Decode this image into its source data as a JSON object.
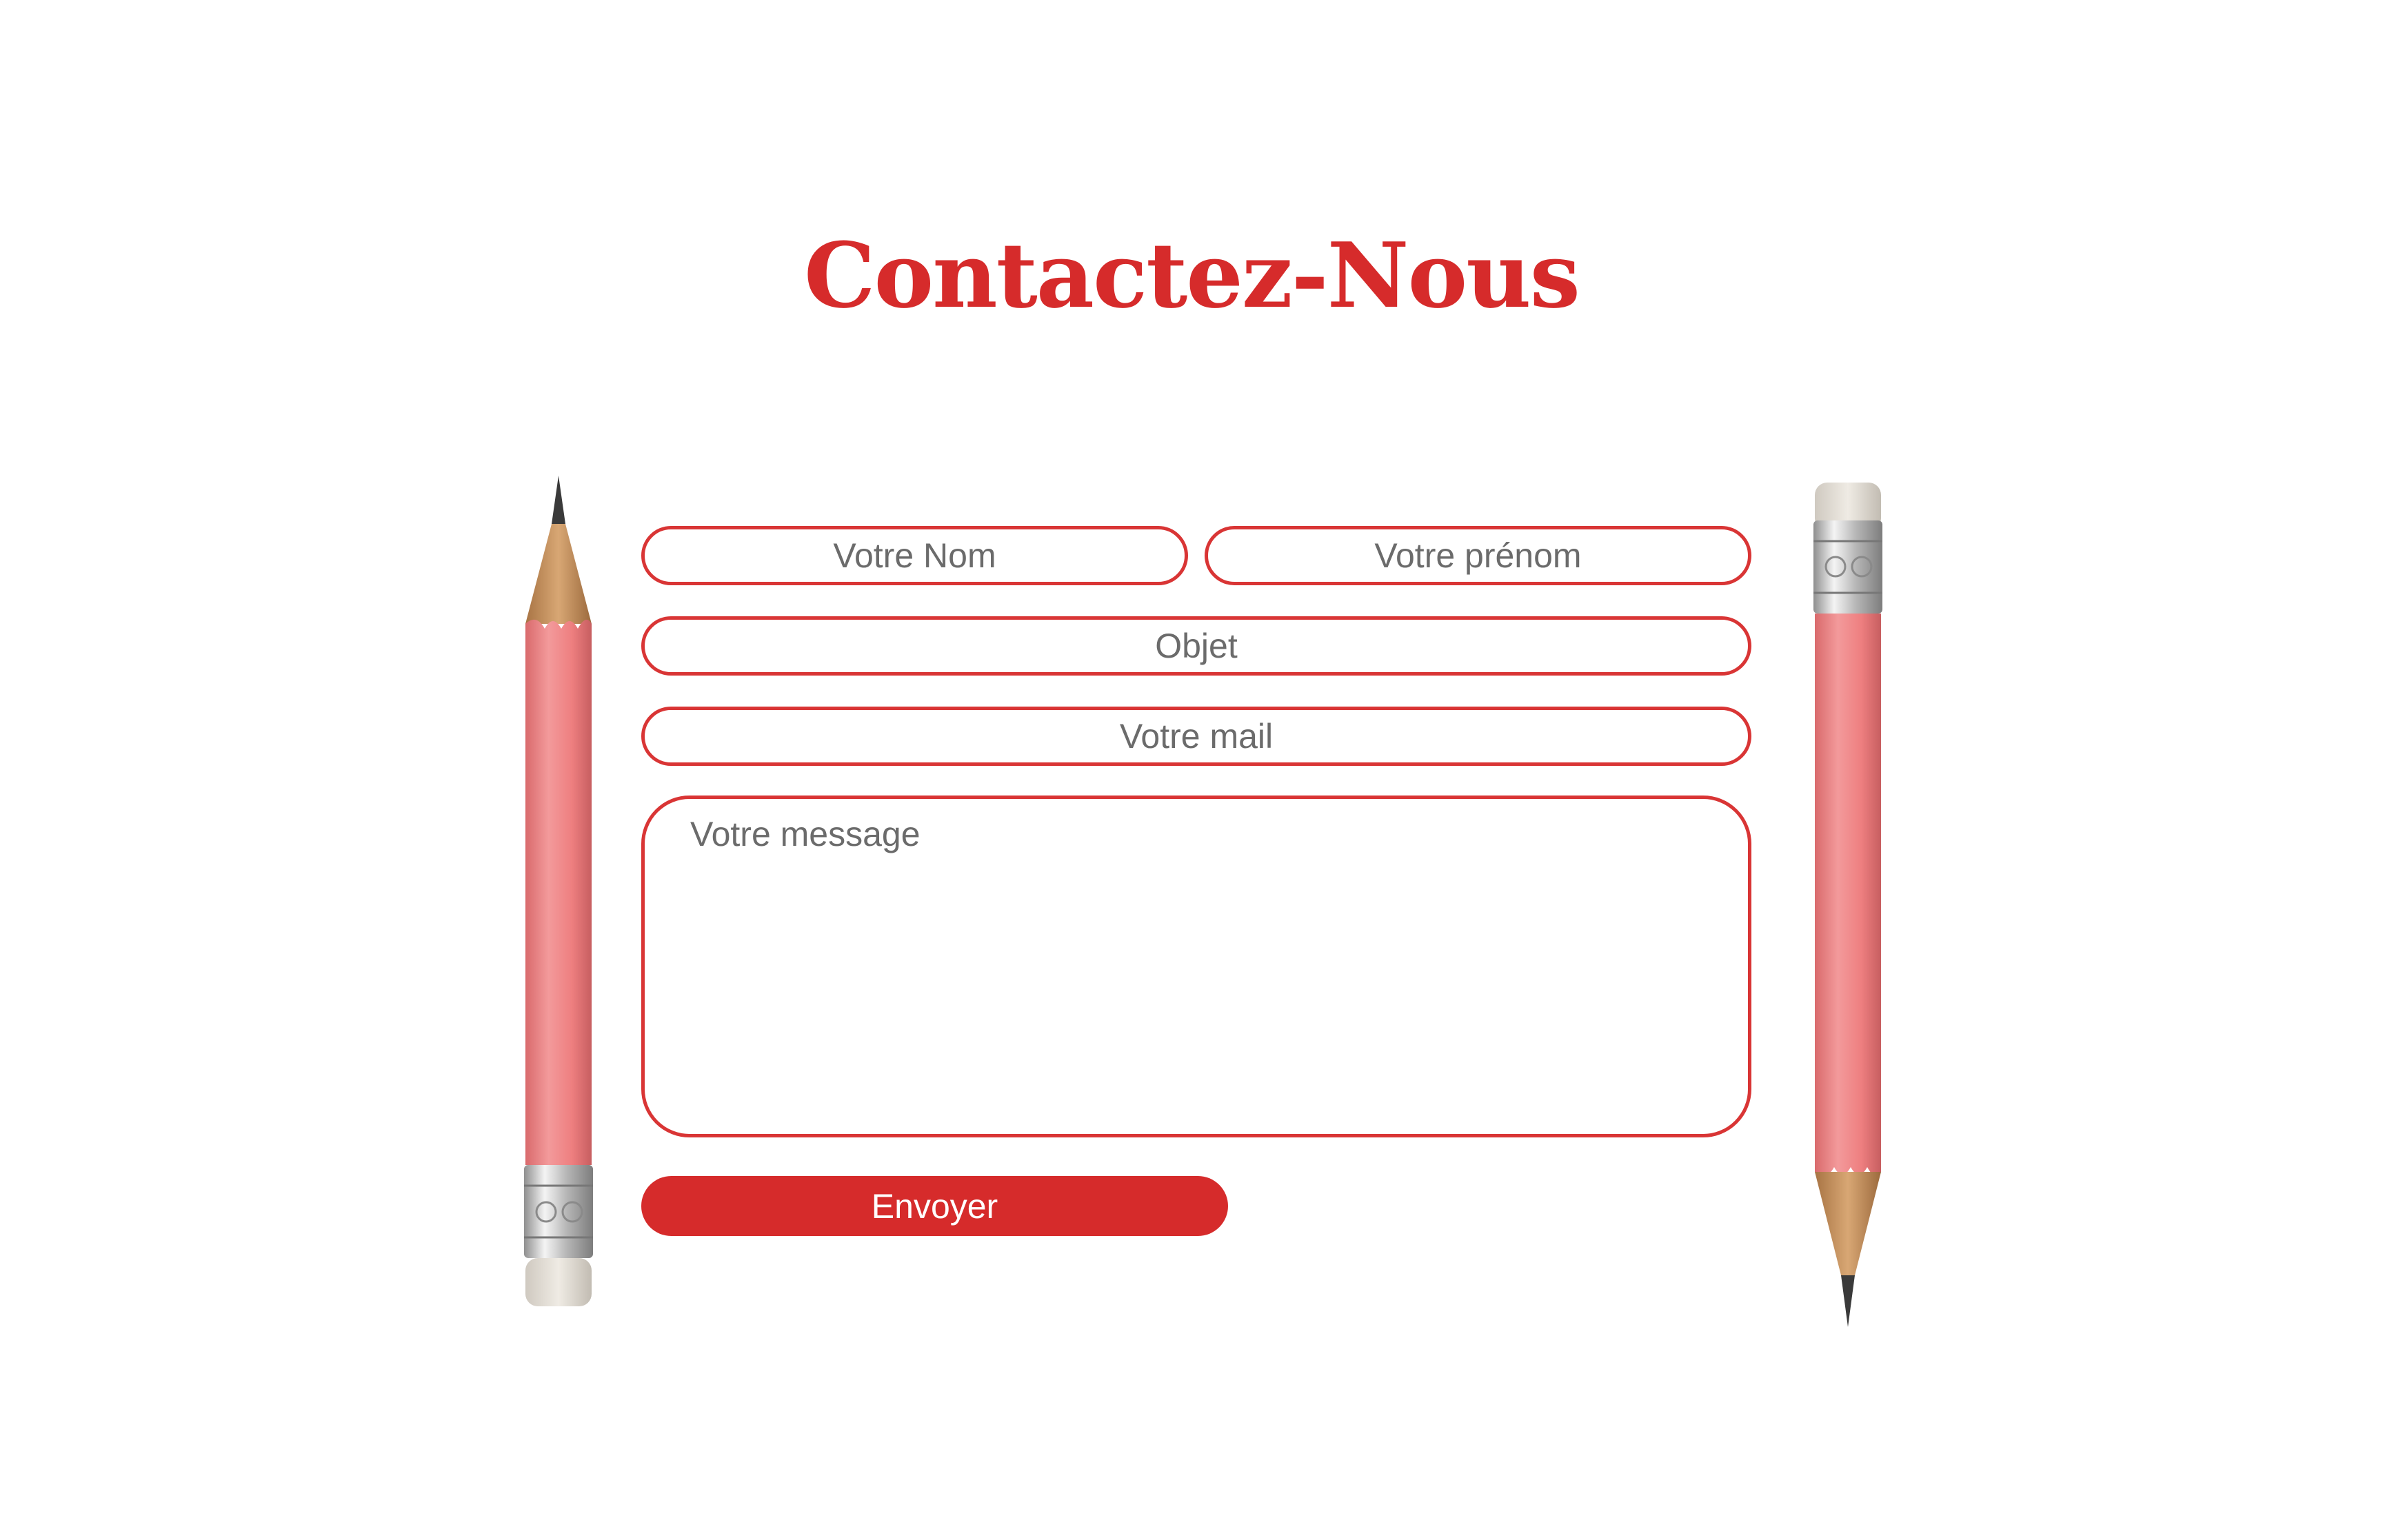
{
  "page": {
    "title": "Contactez-Nous"
  },
  "form": {
    "nom_placeholder": "Votre Nom",
    "prenom_placeholder": "Votre prénom",
    "objet_placeholder": "Objet",
    "mail_placeholder": "Votre mail",
    "message_placeholder": "Votre message",
    "submit_label": "Envoyer"
  },
  "colors": {
    "accent": "#d62b2b",
    "field_border": "#d93535",
    "placeholder": "#6b6b6b",
    "pencil_body": "#ee7f80",
    "pencil_wood": "#c9935e",
    "pencil_ferrule": "#c8c8c8",
    "pencil_eraser": "#e9e4dc"
  },
  "decorations": {
    "left_icon": "pencil-icon",
    "right_icon": "pencil-icon"
  }
}
